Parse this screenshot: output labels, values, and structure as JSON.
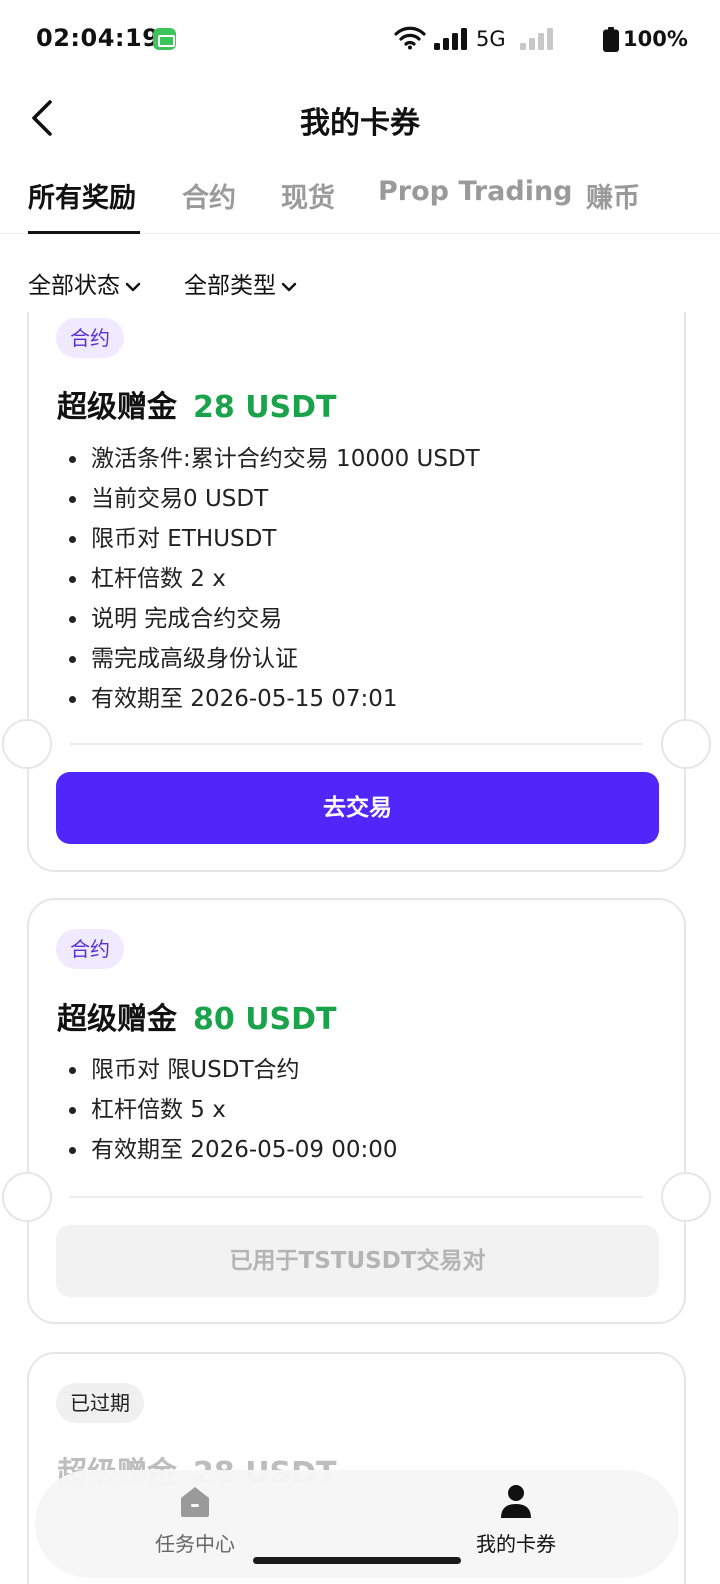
{
  "status_bar": {
    "time": "02:04:19",
    "network": "5G",
    "battery": "100%"
  },
  "header": {
    "title": "我的卡券"
  },
  "tabs": [
    {
      "label": "所有奖励",
      "active": true
    },
    {
      "label": "合约",
      "active": false
    },
    {
      "label": "现货",
      "active": false
    },
    {
      "label": "Prop Trading",
      "active": false
    },
    {
      "label": "赚币",
      "active": false
    }
  ],
  "filters": {
    "status": "全部状态",
    "type": "全部类型"
  },
  "cards": [
    {
      "tag": "合约",
      "title": "超级赠金",
      "amount": "28 USDT",
      "bullets": [
        "激活条件:累计合约交易 10000 USDT",
        "当前交易0 USDT",
        "限币对 ETHUSDT",
        "杠杆倍数 2 x",
        "说明 完成合约交易",
        "需完成高级身份认证",
        "有效期至 2026-05-15 07:01"
      ],
      "button": "去交易"
    },
    {
      "tag": "合约",
      "title": "超级赠金",
      "amount": "80 USDT",
      "bullets": [
        "限币对 限USDT合约",
        "杠杆倍数 5 x",
        "有效期至 2026-05-09 00:00"
      ],
      "button": "已用于TSTUSDT交易对"
    },
    {
      "tag": "已过期",
      "title": "超级赠金",
      "amount": "28 USDT"
    }
  ],
  "bottom_nav": [
    {
      "label": "任务中心",
      "icon": "home-icon",
      "active": false
    },
    {
      "label": "我的卡券",
      "icon": "person-icon",
      "active": true
    }
  ],
  "colors": {
    "accent": "#5126fa",
    "amount": "#1aa34a",
    "tag_bg": "#efeaff",
    "tag_text": "#5733d6"
  }
}
